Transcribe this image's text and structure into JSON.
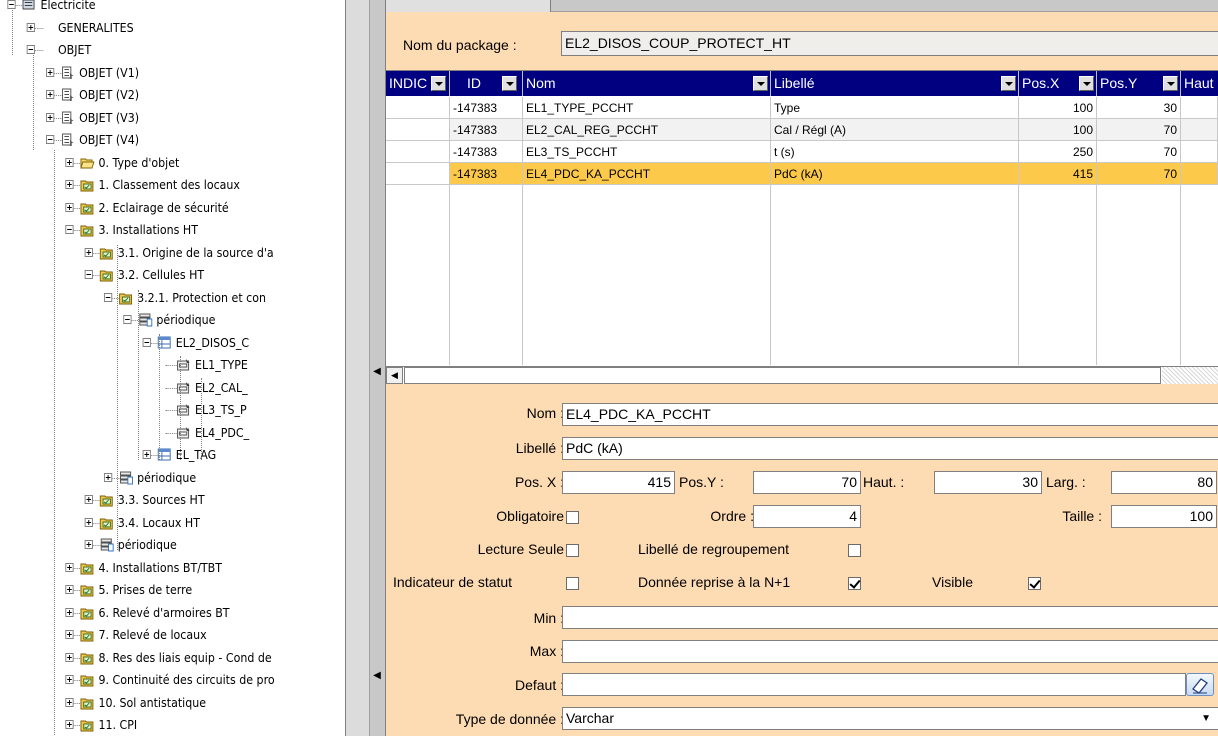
{
  "tree": {
    "items": [
      {
        "label": "Electricite",
        "icon": "database-icon",
        "level": 0,
        "exp": "minus"
      },
      {
        "label": "GENERALITES",
        "icon": "",
        "level": 1,
        "exp": "plus"
      },
      {
        "label": "OBJET",
        "icon": "",
        "level": 1,
        "exp": "minus"
      },
      {
        "label": "OBJET (V1)",
        "icon": "document-icon",
        "level": 2,
        "exp": "plus"
      },
      {
        "label": "OBJET (V2)",
        "icon": "document-icon",
        "level": 2,
        "exp": "plus"
      },
      {
        "label": "OBJET (V3)",
        "icon": "document-icon",
        "level": 2,
        "exp": "plus"
      },
      {
        "label": "OBJET (V4)",
        "icon": "document-icon",
        "level": 2,
        "exp": "minus"
      },
      {
        "label": "0. Type d'objet",
        "icon": "folder-open-icon",
        "level": 3,
        "exp": "plus"
      },
      {
        "label": "1. Classement des locaux",
        "icon": "form-folder-icon",
        "level": 3,
        "exp": "plus"
      },
      {
        "label": "2. Eclairage de sécurité",
        "icon": "form-folder-icon",
        "level": 3,
        "exp": "plus"
      },
      {
        "label": "3. Installations HT",
        "icon": "form-folder-icon",
        "level": 3,
        "exp": "minus"
      },
      {
        "label": "3.1. Origine de la source d'a",
        "icon": "form-folder-icon",
        "level": 4,
        "exp": "plus"
      },
      {
        "label": "3.2. Cellules HT",
        "icon": "form-folder-icon",
        "level": 4,
        "exp": "minus"
      },
      {
        "label": "3.2.1. Protection et con",
        "icon": "form-folder-icon",
        "level": 5,
        "exp": "minus"
      },
      {
        "label": "périodique",
        "icon": "list-icon",
        "level": 6,
        "exp": "minus"
      },
      {
        "label": "EL2_DISOS_C",
        "icon": "table-icon",
        "level": 7,
        "exp": "minus"
      },
      {
        "label": "EL1_TYPE",
        "icon": "field-icon",
        "level": 8,
        "exp": ""
      },
      {
        "label": "EL2_CAL_",
        "icon": "field-icon",
        "level": 8,
        "exp": ""
      },
      {
        "label": "EL3_TS_P",
        "icon": "field-icon",
        "level": 8,
        "exp": ""
      },
      {
        "label": "EL4_PDC_",
        "icon": "field-icon",
        "level": 8,
        "exp": "",
        "selected": true
      },
      {
        "label": "EL_TAG",
        "icon": "table-icon",
        "level": 7,
        "exp": "plus"
      },
      {
        "label": "périodique",
        "icon": "list-icon",
        "level": 5,
        "exp": "plus"
      },
      {
        "label": "3.3. Sources HT",
        "icon": "form-folder-icon",
        "level": 4,
        "exp": "plus"
      },
      {
        "label": "3.4. Locaux HT",
        "icon": "form-folder-icon",
        "level": 4,
        "exp": "plus"
      },
      {
        "label": "périodique",
        "icon": "list-icon",
        "level": 4,
        "exp": "plus"
      },
      {
        "label": "4. Installations BT/TBT",
        "icon": "form-folder-icon",
        "level": 3,
        "exp": "plus"
      },
      {
        "label": "5. Prises de terre",
        "icon": "form-folder-icon",
        "level": 3,
        "exp": "plus"
      },
      {
        "label": "6. Relevé d'armoires BT",
        "icon": "form-folder-icon",
        "level": 3,
        "exp": "plus"
      },
      {
        "label": "7. Relevé de locaux",
        "icon": "form-folder-icon",
        "level": 3,
        "exp": "plus"
      },
      {
        "label": "8. Res des liais equip - Cond de",
        "icon": "form-folder-icon",
        "level": 3,
        "exp": "plus"
      },
      {
        "label": "9. Continuité des circuits de pro",
        "icon": "form-folder-icon",
        "level": 3,
        "exp": "plus"
      },
      {
        "label": "10. Sol antistatique",
        "icon": "form-folder-icon",
        "level": 3,
        "exp": "plus"
      },
      {
        "label": "11. CPI",
        "icon": "form-folder-icon",
        "level": 3,
        "exp": "plus"
      }
    ]
  },
  "package": {
    "label": "Nom du package :",
    "value": "EL2_DISOS_COUP_PROTECT_HT"
  },
  "grid": {
    "headers": [
      "INDIC",
      "ID",
      "Nom",
      "Libellé",
      "Pos.X",
      "Pos.Y",
      "Haut"
    ],
    "rows": [
      {
        "indic": "",
        "id": "-147383",
        "nom": "EL1_TYPE_PCCHT",
        "libelle": "Type",
        "posx": "100",
        "posy": "30"
      },
      {
        "indic": "",
        "id": "-147383",
        "nom": "EL2_CAL_REG_PCCHT",
        "libelle": "Cal / Régl (A)",
        "posx": "100",
        "posy": "70"
      },
      {
        "indic": "",
        "id": "-147383",
        "nom": "EL3_TS_PCCHT",
        "libelle": "t (s)",
        "posx": "250",
        "posy": "70"
      },
      {
        "indic": "",
        "id": "-147383",
        "nom": "EL4_PDC_KA_PCCHT",
        "libelle": "PdC (kA)",
        "posx": "415",
        "posy": "70"
      }
    ],
    "selected_row": 3
  },
  "form": {
    "nom_label": "Nom :",
    "nom_value": "EL4_PDC_KA_PCCHT",
    "libelle_label": "Libellé :",
    "libelle_value": "PdC (kA)",
    "posx_label": "Pos. X :",
    "posx_value": "415",
    "posy_label": "Pos.Y :",
    "posy_value": "70",
    "haut_label": "Haut. :",
    "haut_value": "30",
    "larg_label": "Larg. :",
    "larg_value": "80",
    "obligatoire_label": "Obligatoire",
    "obligatoire_checked": false,
    "ordre_label": "Ordre :",
    "ordre_value": "4",
    "taille_label": "Taille :",
    "taille_value": "100",
    "lecture_label": "Lecture Seule",
    "lecture_checked": false,
    "regroup_label": "Libellé de regroupement",
    "regroup_checked": false,
    "statut_label": "Indicateur de statut",
    "statut_checked": false,
    "reprise_label": "Donnée reprise à la N+1",
    "reprise_checked": true,
    "visible_label": "Visible",
    "visible_checked": true,
    "min_label": "Min :",
    "min_value": "",
    "max_label": "Max :",
    "max_value": "",
    "defaut_label": "Defaut :",
    "defaut_value": "",
    "type_label": "Type de donnée :",
    "type_value": "Varchar"
  },
  "colors": {
    "panel_bg": "#fddcb4",
    "grid_header": "#000080",
    "selected_row": "#fcc94a"
  }
}
